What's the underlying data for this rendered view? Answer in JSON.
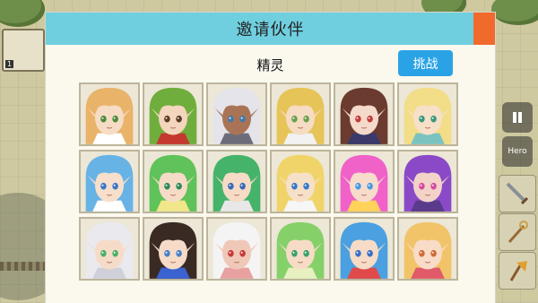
{
  "dialog": {
    "title": "邀请伙伴",
    "category": "精灵",
    "challenge_label": "挑战"
  },
  "hud": {
    "level_badge": "1",
    "hero_label": "Hero"
  },
  "characters": [
    {
      "row": 1,
      "hair": "#e9b36a",
      "skin": "#f6dcc4",
      "eyes": "#4a8a3c",
      "accent": "#ffffff",
      "locked": false
    },
    {
      "row": 1,
      "hair": "#6fae3c",
      "skin": "#f3d6bd",
      "eyes": "#5a3c24",
      "accent": "#c4382f",
      "locked": false
    },
    {
      "row": 1,
      "hair": "#e4e4ea",
      "skin": "#a97456",
      "eyes": "#3f7aa8",
      "accent": "#6c6c7a",
      "locked": false
    },
    {
      "row": 1,
      "hair": "#e6c458",
      "skin": "#f5dcc2",
      "eyes": "#6aa04a",
      "accent": "#f2f2f2",
      "locked": false
    },
    {
      "row": 1,
      "hair": "#6a3b2e",
      "skin": "#f4dacb",
      "eyes": "#c43a3a",
      "accent": "#3a3a6a",
      "locked": false
    },
    {
      "row": 1,
      "hair": "#f2dd88",
      "skin": "#f7e0c8",
      "eyes": "#3a9a7a",
      "accent": "#7ac3c0",
      "locked": false
    },
    {
      "row": 2,
      "hair": "#68b3e6",
      "skin": "#f7dfcb",
      "eyes": "#3a78c8",
      "accent": "#ffffff",
      "locked": true
    },
    {
      "row": 2,
      "hair": "#5fc25a",
      "skin": "#f6dcc6",
      "eyes": "#2f8a5a",
      "accent": "#f2e68a",
      "locked": true
    },
    {
      "row": 2,
      "hair": "#46b36a",
      "skin": "#f6dcc6",
      "eyes": "#3a6ab8",
      "accent": "#e8e8e8",
      "locked": true
    },
    {
      "row": 2,
      "hair": "#f0d46a",
      "skin": "#f7e0c8",
      "eyes": "#3a7ac8",
      "accent": "#f6f6f6",
      "locked": true
    },
    {
      "row": 2,
      "hair": "#f062c8",
      "skin": "#f7dccb",
      "eyes": "#4a9ae0",
      "accent": "#ffd25a",
      "locked": true
    },
    {
      "row": 2,
      "hair": "#8a4ac8",
      "skin": "#f3d3c8",
      "eyes": "#d84aa0",
      "accent": "#5a3a8a",
      "locked": true
    },
    {
      "row": 3,
      "hair": "#e9e9ee",
      "skin": "#f6dcc8",
      "eyes": "#4ab06a",
      "accent": "#d0d0da",
      "locked": true
    },
    {
      "row": 3,
      "hair": "#3a2a24",
      "skin": "#f6dcc8",
      "eyes": "#4a80c8",
      "accent": "#3a62d0",
      "locked": true
    },
    {
      "row": 3,
      "hair": "#f4f4f4",
      "skin": "#f0c8b8",
      "eyes": "#c83a3a",
      "accent": "#e8a0a0",
      "locked": true
    },
    {
      "row": 3,
      "hair": "#86d06a",
      "skin": "#f6dcc6",
      "eyes": "#3aa06a",
      "accent": "#e6f0c0",
      "locked": true
    },
    {
      "row": 3,
      "hair": "#4aa0e0",
      "skin": "#f6dcc6",
      "eyes": "#3a70c8",
      "accent": "#e04a4a",
      "locked": true
    },
    {
      "row": 3,
      "hair": "#f2c46a",
      "skin": "#f8dcc8",
      "eyes": "#d06a3a",
      "accent": "#e05a6a",
      "locked": true
    }
  ],
  "colors": {
    "header": "#6fcfdf",
    "button": "#2aa3e6",
    "close_tab": "#f06a2c",
    "panel": "#fbf8ee"
  },
  "icons": [
    "lock-icon",
    "pause-icon",
    "sword-icon",
    "staff-icon",
    "axe-icon"
  ]
}
